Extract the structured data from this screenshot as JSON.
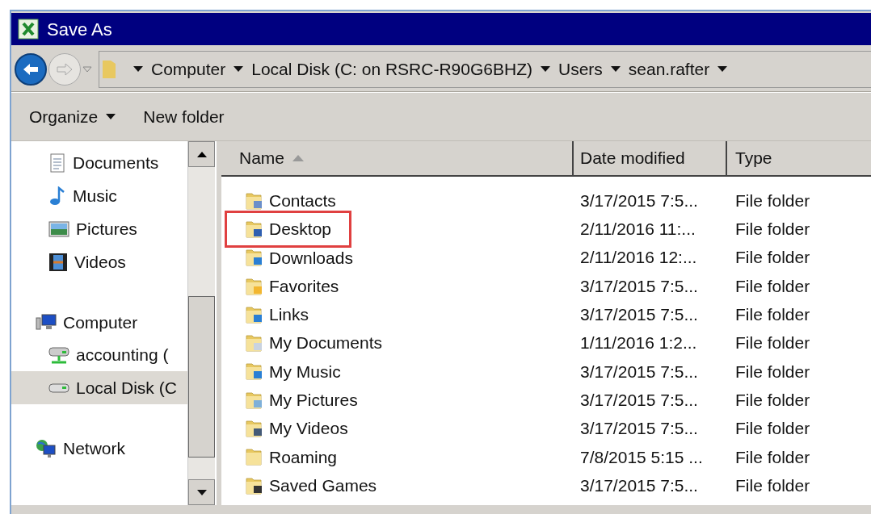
{
  "window": {
    "title": "Save As"
  },
  "breadcrumbs": [
    "Computer",
    "Local Disk (C: on RSRC-R90G6BHZ)",
    "Users",
    "sean.rafter"
  ],
  "toolbar": {
    "organize": "Organize",
    "new_folder": "New folder"
  },
  "sidebar": {
    "groups": [
      {
        "children": [
          {
            "label": "Documents",
            "selected": false
          },
          {
            "label": "Music",
            "selected": false
          },
          {
            "label": "Pictures",
            "selected": false
          },
          {
            "label": "Videos",
            "selected": false
          }
        ]
      },
      {
        "label": "Computer",
        "children": [
          {
            "label": "accounting (",
            "selected": false
          },
          {
            "label": "Local Disk (C",
            "selected": true
          }
        ]
      },
      {
        "label": "Network"
      }
    ]
  },
  "table": {
    "columns": [
      "Name",
      "Date modified",
      "Type"
    ],
    "rows": [
      {
        "name": "Contacts",
        "date": "3/17/2015 7:5...",
        "type": "File folder",
        "highlighted": false
      },
      {
        "name": "Desktop",
        "date": "2/11/2016 11:...",
        "type": "File folder",
        "highlighted": true
      },
      {
        "name": "Downloads",
        "date": "2/11/2016 12:...",
        "type": "File folder",
        "highlighted": false
      },
      {
        "name": "Favorites",
        "date": "3/17/2015 7:5...",
        "type": "File folder",
        "highlighted": false
      },
      {
        "name": "Links",
        "date": "3/17/2015 7:5...",
        "type": "File folder",
        "highlighted": false
      },
      {
        "name": "My Documents",
        "date": "1/11/2016 1:2...",
        "type": "File folder",
        "highlighted": false
      },
      {
        "name": "My Music",
        "date": "3/17/2015 7:5...",
        "type": "File folder",
        "highlighted": false
      },
      {
        "name": "My Pictures",
        "date": "3/17/2015 7:5...",
        "type": "File folder",
        "highlighted": false
      },
      {
        "name": "My Videos",
        "date": "3/17/2015 7:5...",
        "type": "File folder",
        "highlighted": false
      },
      {
        "name": "Roaming",
        "date": "7/8/2015 5:15 ...",
        "type": "File folder",
        "highlighted": false
      },
      {
        "name": "Saved Games",
        "date": "3/17/2015 7:5...",
        "type": "File folder",
        "highlighted": false
      }
    ]
  }
}
